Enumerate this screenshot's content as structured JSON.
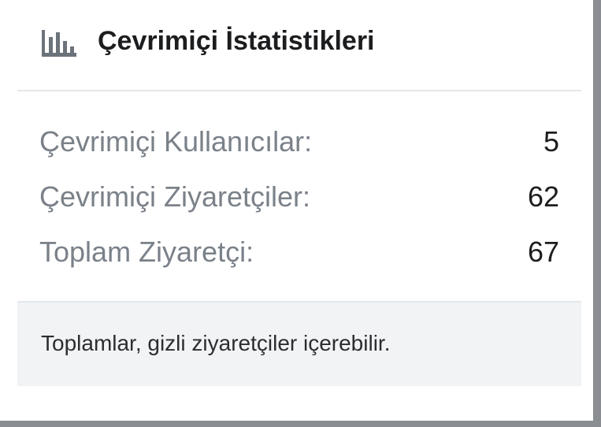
{
  "widget": {
    "title": "Çevrimiçi İstatistikleri",
    "icon": "bar-chart-icon",
    "stats": [
      {
        "label": "Çevrimiçi Kullanıcılar:",
        "value": "5"
      },
      {
        "label": "Çevrimiçi Ziyaretçiler:",
        "value": "62"
      },
      {
        "label": "Toplam Ziyaretçi:",
        "value": "67"
      }
    ],
    "footer_note": "Toplamlar, gizli ziyaretçiler içerebilir."
  },
  "colors": {
    "title_text": "#1c1d1f",
    "label_text": "#7a8189",
    "value_text": "#1c1d1f",
    "footer_background": "#f1f3f4",
    "divider": "#e4e7ea",
    "icon": "#6c737a"
  }
}
